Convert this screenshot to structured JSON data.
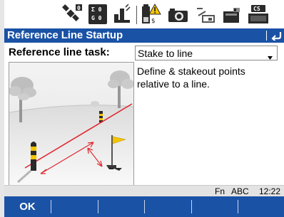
{
  "statusbar": {
    "icons": [
      "satellite-icon",
      "position-accuracy-icon",
      "rtk-radio-icon",
      "instrument-battery-icon",
      "camera-icon",
      "line-tool-icon",
      "sd-card-icon",
      "cs-controller-icon"
    ],
    "accuracy": {
      "row1": "Σ 0",
      "row2": "G 0"
    },
    "controller_badge": "CS",
    "satellite_count": "0"
  },
  "titlebar": {
    "title": "Reference Line Startup"
  },
  "main": {
    "task_label": "Reference line task:",
    "task_select": {
      "value": "Stake to line"
    },
    "description": "Define & stakeout points relative to a line."
  },
  "infoline": {
    "fn": "Fn",
    "input_mode": "ABC",
    "time": "12:22"
  },
  "softkeys": [
    {
      "label": "OK"
    },
    {
      "label": ""
    },
    {
      "label": ""
    },
    {
      "label": ""
    },
    {
      "label": ""
    },
    {
      "label": ""
    }
  ],
  "colors": {
    "titlebar_bg": "#1a52a6",
    "softkey_bg": "#1a52a6",
    "warning_yellow": "#f5c400",
    "line_red": "#e0262e"
  }
}
